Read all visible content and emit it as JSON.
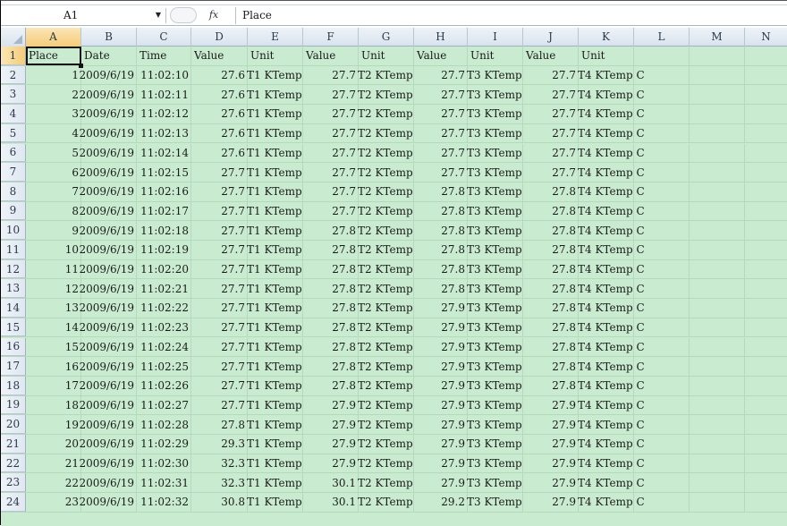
{
  "formula_bar": {
    "name_box": "A1",
    "fx_label": "fx",
    "formula": "Place"
  },
  "columns": [
    "A",
    "B",
    "C",
    "D",
    "E",
    "F",
    "G",
    "H",
    "I",
    "J",
    "K",
    "L",
    "M",
    "N"
  ],
  "header_row": {
    "row_num": "1",
    "cells": [
      "Place",
      "Date",
      "Time",
      "Value",
      "Unit",
      "Value",
      "Unit",
      "Value",
      "Unit",
      "Value",
      "Unit"
    ]
  },
  "rows": [
    {
      "n": "2",
      "place": "1",
      "date": "2009/6/19",
      "time": "11:02:10",
      "v1": "27.6",
      "u1": "T1 KTemp",
      "v2": "27.7",
      "u2": "T2 KTemp",
      "v3": "27.7",
      "u3": "T3 KTemp",
      "v4": "27.7",
      "u4": "T4 KTemp C"
    },
    {
      "n": "3",
      "place": "2",
      "date": "2009/6/19",
      "time": "11:02:11",
      "v1": "27.6",
      "u1": "T1 KTemp",
      "v2": "27.7",
      "u2": "T2 KTemp",
      "v3": "27.7",
      "u3": "T3 KTemp",
      "v4": "27.7",
      "u4": "T4 KTemp C"
    },
    {
      "n": "4",
      "place": "3",
      "date": "2009/6/19",
      "time": "11:02:12",
      "v1": "27.6",
      "u1": "T1 KTemp",
      "v2": "27.7",
      "u2": "T2 KTemp",
      "v3": "27.7",
      "u3": "T3 KTemp",
      "v4": "27.7",
      "u4": "T4 KTemp C"
    },
    {
      "n": "5",
      "place": "4",
      "date": "2009/6/19",
      "time": "11:02:13",
      "v1": "27.6",
      "u1": "T1 KTemp",
      "v2": "27.7",
      "u2": "T2 KTemp",
      "v3": "27.7",
      "u3": "T3 KTemp",
      "v4": "27.7",
      "u4": "T4 KTemp C"
    },
    {
      "n": "6",
      "place": "5",
      "date": "2009/6/19",
      "time": "11:02:14",
      "v1": "27.6",
      "u1": "T1 KTemp",
      "v2": "27.7",
      "u2": "T2 KTemp",
      "v3": "27.7",
      "u3": "T3 KTemp",
      "v4": "27.7",
      "u4": "T4 KTemp C"
    },
    {
      "n": "7",
      "place": "6",
      "date": "2009/6/19",
      "time": "11:02:15",
      "v1": "27.7",
      "u1": "T1 KTemp",
      "v2": "27.7",
      "u2": "T2 KTemp",
      "v3": "27.7",
      "u3": "T3 KTemp",
      "v4": "27.7",
      "u4": "T4 KTemp C"
    },
    {
      "n": "8",
      "place": "7",
      "date": "2009/6/19",
      "time": "11:02:16",
      "v1": "27.7",
      "u1": "T1 KTemp",
      "v2": "27.7",
      "u2": "T2 KTemp",
      "v3": "27.8",
      "u3": "T3 KTemp",
      "v4": "27.8",
      "u4": "T4 KTemp C"
    },
    {
      "n": "9",
      "place": "8",
      "date": "2009/6/19",
      "time": "11:02:17",
      "v1": "27.7",
      "u1": "T1 KTemp",
      "v2": "27.7",
      "u2": "T2 KTemp",
      "v3": "27.8",
      "u3": "T3 KTemp",
      "v4": "27.8",
      "u4": "T4 KTemp C"
    },
    {
      "n": "10",
      "place": "9",
      "date": "2009/6/19",
      "time": "11:02:18",
      "v1": "27.7",
      "u1": "T1 KTemp",
      "v2": "27.8",
      "u2": "T2 KTemp",
      "v3": "27.8",
      "u3": "T3 KTemp",
      "v4": "27.8",
      "u4": "T4 KTemp C"
    },
    {
      "n": "11",
      "place": "10",
      "date": "2009/6/19",
      "time": "11:02:19",
      "v1": "27.7",
      "u1": "T1 KTemp",
      "v2": "27.8",
      "u2": "T2 KTemp",
      "v3": "27.8",
      "u3": "T3 KTemp",
      "v4": "27.8",
      "u4": "T4 KTemp C"
    },
    {
      "n": "12",
      "place": "11",
      "date": "2009/6/19",
      "time": "11:02:20",
      "v1": "27.7",
      "u1": "T1 KTemp",
      "v2": "27.8",
      "u2": "T2 KTemp",
      "v3": "27.8",
      "u3": "T3 KTemp",
      "v4": "27.8",
      "u4": "T4 KTemp C"
    },
    {
      "n": "13",
      "place": "12",
      "date": "2009/6/19",
      "time": "11:02:21",
      "v1": "27.7",
      "u1": "T1 KTemp",
      "v2": "27.8",
      "u2": "T2 KTemp",
      "v3": "27.8",
      "u3": "T3 KTemp",
      "v4": "27.8",
      "u4": "T4 KTemp C"
    },
    {
      "n": "14",
      "place": "13",
      "date": "2009/6/19",
      "time": "11:02:22",
      "v1": "27.7",
      "u1": "T1 KTemp",
      "v2": "27.8",
      "u2": "T2 KTemp",
      "v3": "27.9",
      "u3": "T3 KTemp",
      "v4": "27.8",
      "u4": "T4 KTemp C"
    },
    {
      "n": "15",
      "place": "14",
      "date": "2009/6/19",
      "time": "11:02:23",
      "v1": "27.7",
      "u1": "T1 KTemp",
      "v2": "27.8",
      "u2": "T2 KTemp",
      "v3": "27.9",
      "u3": "T3 KTemp",
      "v4": "27.8",
      "u4": "T4 KTemp C"
    },
    {
      "n": "16",
      "place": "15",
      "date": "2009/6/19",
      "time": "11:02:24",
      "v1": "27.7",
      "u1": "T1 KTemp",
      "v2": "27.8",
      "u2": "T2 KTemp",
      "v3": "27.9",
      "u3": "T3 KTemp",
      "v4": "27.8",
      "u4": "T4 KTemp C"
    },
    {
      "n": "17",
      "place": "16",
      "date": "2009/6/19",
      "time": "11:02:25",
      "v1": "27.7",
      "u1": "T1 KTemp",
      "v2": "27.8",
      "u2": "T2 KTemp",
      "v3": "27.9",
      "u3": "T3 KTemp",
      "v4": "27.8",
      "u4": "T4 KTemp C"
    },
    {
      "n": "18",
      "place": "17",
      "date": "2009/6/19",
      "time": "11:02:26",
      "v1": "27.7",
      "u1": "T1 KTemp",
      "v2": "27.8",
      "u2": "T2 KTemp",
      "v3": "27.9",
      "u3": "T3 KTemp",
      "v4": "27.8",
      "u4": "T4 KTemp C"
    },
    {
      "n": "19",
      "place": "18",
      "date": "2009/6/19",
      "time": "11:02:27",
      "v1": "27.7",
      "u1": "T1 KTemp",
      "v2": "27.9",
      "u2": "T2 KTemp",
      "v3": "27.9",
      "u3": "T3 KTemp",
      "v4": "27.9",
      "u4": "T4 KTemp C"
    },
    {
      "n": "20",
      "place": "19",
      "date": "2009/6/19",
      "time": "11:02:28",
      "v1": "27.8",
      "u1": "T1 KTemp",
      "v2": "27.9",
      "u2": "T2 KTemp",
      "v3": "27.9",
      "u3": "T3 KTemp",
      "v4": "27.9",
      "u4": "T4 KTemp C"
    },
    {
      "n": "21",
      "place": "20",
      "date": "2009/6/19",
      "time": "11:02:29",
      "v1": "29.3",
      "u1": "T1 KTemp",
      "v2": "27.9",
      "u2": "T2 KTemp",
      "v3": "27.9",
      "u3": "T3 KTemp",
      "v4": "27.9",
      "u4": "T4 KTemp C"
    },
    {
      "n": "22",
      "place": "21",
      "date": "2009/6/19",
      "time": "11:02:30",
      "v1": "32.3",
      "u1": "T1 KTemp",
      "v2": "27.9",
      "u2": "T2 KTemp",
      "v3": "27.9",
      "u3": "T3 KTemp",
      "v4": "27.9",
      "u4": "T4 KTemp C"
    },
    {
      "n": "23",
      "place": "22",
      "date": "2009/6/19",
      "time": "11:02:31",
      "v1": "32.3",
      "u1": "T1 KTemp",
      "v2": "30.1",
      "u2": "T2 KTemp",
      "v3": "27.9",
      "u3": "T3 KTemp",
      "v4": "27.9",
      "u4": "T4 KTemp C"
    },
    {
      "n": "24",
      "place": "23",
      "date": "2009/6/19",
      "time": "11:02:32",
      "v1": "30.8",
      "u1": "T1 KTemp",
      "v2": "30.1",
      "u2": "T2 KTemp",
      "v3": "29.2",
      "u3": "T3 KTemp",
      "v4": "27.9",
      "u4": "T4 KTemp C"
    }
  ],
  "colors": {
    "sheet_bg": "#c9ecd1",
    "header_bg": "#dfe7f0",
    "selected_header": "#f5cc79"
  }
}
